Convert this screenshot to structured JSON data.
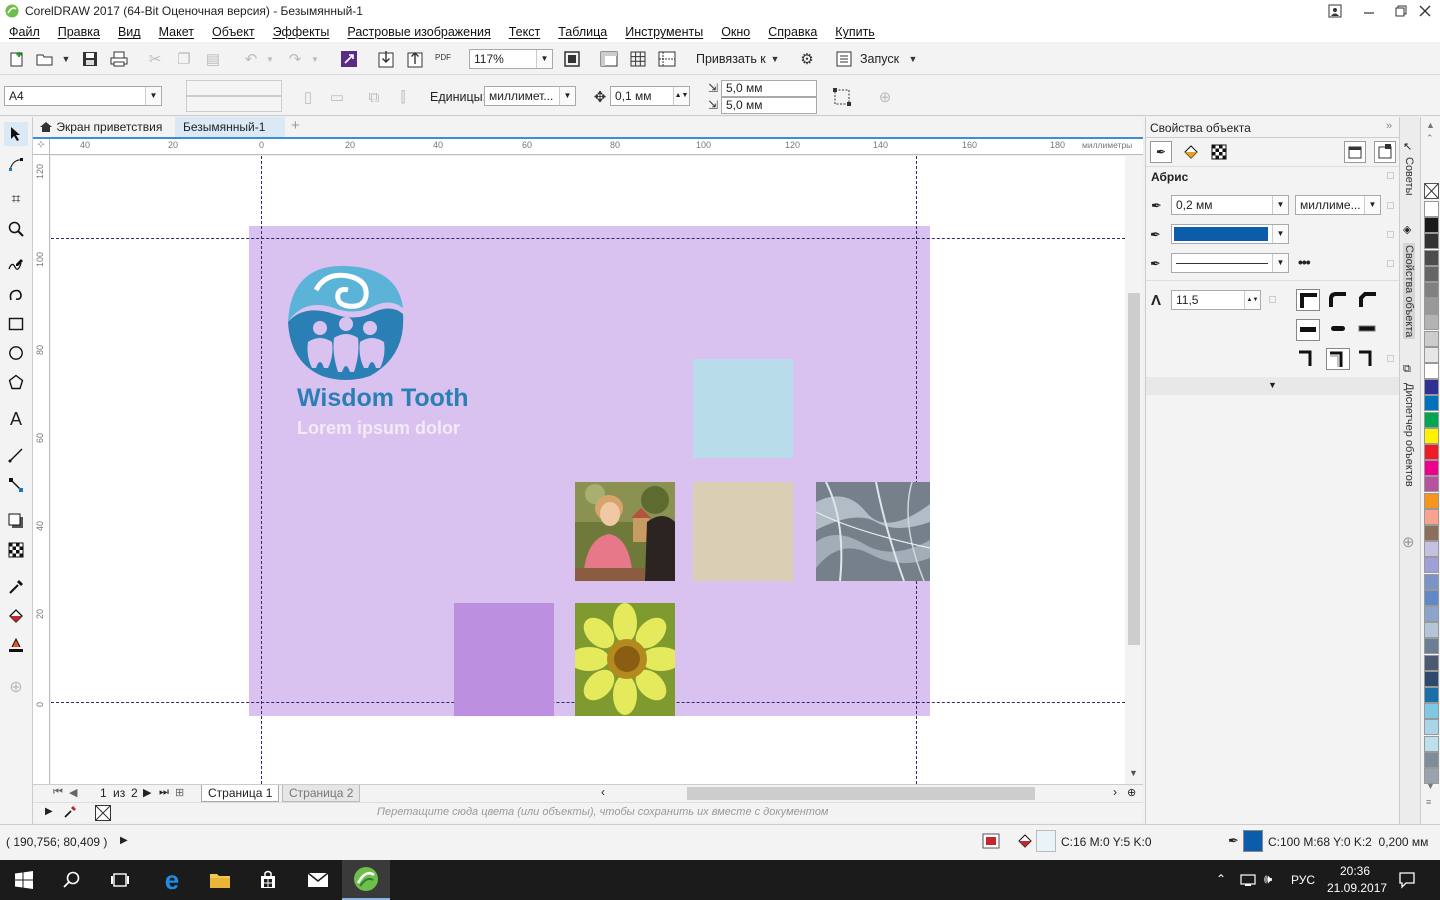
{
  "window": {
    "title": "CorelDRAW 2017 (64-Bit Оценочная версия) - Безымянный-1"
  },
  "menu": [
    "Файл",
    "Правка",
    "Вид",
    "Макет",
    "Объект",
    "Эффекты",
    "Растровые изображения",
    "Текст",
    "Таблица",
    "Инструменты",
    "Окно",
    "Справка",
    "Купить"
  ],
  "toolbar": {
    "zoom": "117%",
    "snap_label": "Привязать к",
    "launch_label": "Запуск",
    "pdf_label": "PDF"
  },
  "propbar": {
    "page_size": "A4",
    "units_label": "Единицы:",
    "units_value": "миллимет...",
    "nudge": "0,1 мм",
    "dup_x": "5,0 мм",
    "dup_y": "5,0 мм"
  },
  "tabs": {
    "welcome": "Экран приветствия",
    "document": "Безымянный-1"
  },
  "ruler": {
    "h_ticks": [
      "40",
      "20",
      "0",
      "20",
      "40",
      "60",
      "80",
      "100",
      "120",
      "140",
      "160",
      "180"
    ],
    "unit": "миллиметры",
    "v_ticks": [
      "120",
      "100",
      "80",
      "60",
      "40",
      "20",
      "0"
    ]
  },
  "design": {
    "brand": "Wisdom Tooth",
    "tagline": "Lorem ipsum dolor",
    "colors": {
      "background": "#d9c2ef",
      "brand_blue": "#2a7fb5",
      "light_blue": "#b8dcea",
      "beige": "#d9cfb5",
      "purple": "#bd8fe0"
    }
  },
  "pages": {
    "current": "1",
    "of_label": "из",
    "total": "2",
    "tabs": [
      "Страница 1",
      "Страница 2"
    ]
  },
  "colorbar_hint": "Перетащите сюда цвета (или объекты), чтобы сохранить их вместе с документом",
  "status": {
    "coords": "( 190,756; 80,409 )",
    "fill": "C:16 M:0 Y:5 K:0",
    "outline": "C:100 M:68 Y:0 K:2  0,200 мм",
    "fill_color": "#eaf4f8",
    "outline_color": "#0b5cab"
  },
  "docker": {
    "title": "Свойства объекта",
    "section": "Абрис",
    "width": "0,2 мм",
    "units": "миллиме...",
    "color": "#0b5cab",
    "miter": "11,5",
    "vtab_hints": "Советы",
    "vtab_props": "Свойства объекта",
    "vtab_objects": "Диспетчер объектов"
  },
  "palette": [
    "#ffffff",
    "#1a1a1a",
    "#333333",
    "#4d4d4d",
    "#666666",
    "#808080",
    "#999999",
    "#b3b3b3",
    "#cccccc",
    "#e6e6e6",
    "#ffffff",
    "#2e3192",
    "#0072bc",
    "#00a651",
    "#fff200",
    "#ed1c24",
    "#ec008c",
    "#b5539f",
    "#f7941d",
    "#f9a28f",
    "#8b6f5c",
    "#c4c1e3",
    "#9f9fd9",
    "#7b93c7",
    "#5f8ac7",
    "#8aa5c9",
    "#b4c5da",
    "#6a7e96",
    "#4b5a70",
    "#2c4a6e",
    "#1b6fa8",
    "#7ec8e3",
    "#aad4e8",
    "#bde0ef",
    "#7f8c99",
    "#9aa3ad"
  ],
  "taskbar": {
    "lang": "РУС",
    "time": "20:36",
    "date": "21.09.2017"
  }
}
